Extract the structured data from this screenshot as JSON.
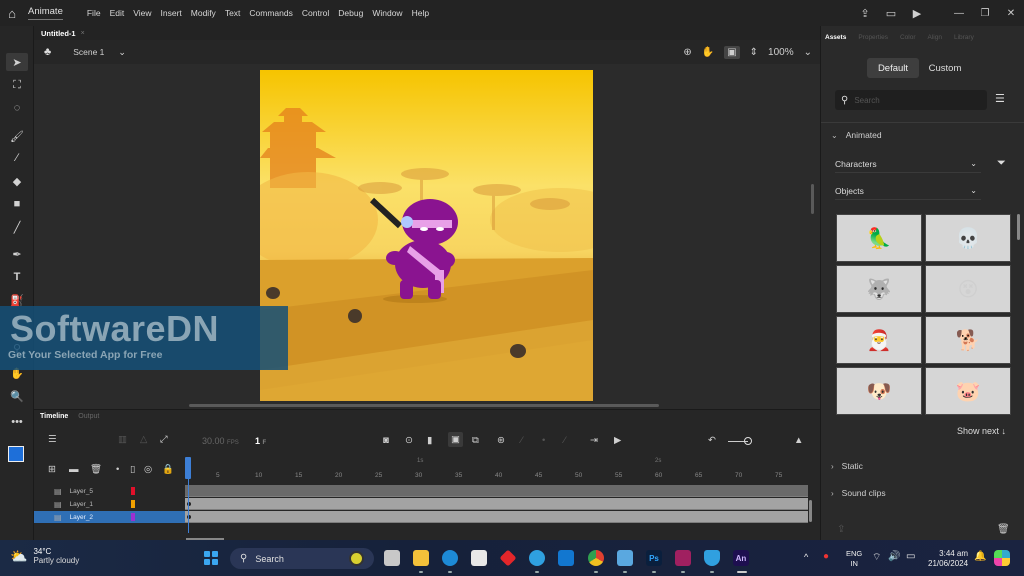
{
  "menubar": {
    "app_name": "Animate",
    "menus": [
      "File",
      "Edit",
      "View",
      "Insert",
      "Modify",
      "Text",
      "Commands",
      "Control",
      "Debug",
      "Window",
      "Help"
    ],
    "icons": [
      "share-icon",
      "workspace-icon",
      "play-preview-icon"
    ],
    "window_controls": [
      "minimize-icon",
      "restore-icon",
      "close-icon"
    ]
  },
  "document": {
    "tab_title": "Untitled-1",
    "tab_close": "×"
  },
  "stage_toolbar": {
    "scene_label": "Scene 1",
    "zoom_value": "100%"
  },
  "toolbox": {
    "tools": [
      "selection-tool",
      "free-transform-tool",
      "lasso-tool",
      "paint-brush-tool",
      "brush-tool",
      "eraser-tool",
      "rectangle-tool",
      "line-tool",
      "pen-tool",
      "text-tool",
      "paint-bucket-tool",
      "eyedropper-tool",
      "bone-tool",
      "hand-tool",
      "zoom-tool",
      "more-tools"
    ],
    "stroke_color": "#000000",
    "fill_color": "#1e6fd9"
  },
  "watermark": {
    "title": "SoftwareDN",
    "subtitle": "Get Your Selected App for Free"
  },
  "timeline": {
    "tabs": [
      "Timeline",
      "Output"
    ],
    "fps": "30.00",
    "fps_unit": "FPS",
    "current_frame": "1",
    "frame_unit": "F",
    "ruler": [
      "5",
      "10",
      "15",
      "20",
      "25",
      "30",
      "35",
      "40",
      "45",
      "50",
      "55",
      "60",
      "65",
      "70",
      "75"
    ],
    "ruler_markers": [
      "1s",
      "2s"
    ],
    "layers": [
      {
        "name": "Layer_5",
        "color": "#e0102a",
        "selected": false
      },
      {
        "name": "Layer_1",
        "color": "#f0a000",
        "selected": false
      },
      {
        "name": "Layer_2",
        "color": "#9b30d0",
        "selected": true
      }
    ]
  },
  "right_panel": {
    "tabs": [
      "Assets",
      "Properties",
      "Color",
      "Align",
      "Library"
    ],
    "active_tab": "Assets",
    "segments": [
      "Default",
      "Custom"
    ],
    "active_segment": "Default",
    "search_placeholder": "Search",
    "sections": {
      "animated": "Animated",
      "static": "Static",
      "sound_clips": "Sound clips"
    },
    "dropdowns": {
      "category": "Characters",
      "subcategory": "Objects"
    },
    "assets": [
      {
        "name": "parrot",
        "glyph": "🦜"
      },
      {
        "name": "skeleton",
        "glyph": "💀"
      },
      {
        "name": "wolf",
        "glyph": "🐺"
      },
      {
        "name": "dazed-character",
        "glyph": "😵"
      },
      {
        "name": "santa",
        "glyph": "🎅"
      },
      {
        "name": "dog-lying",
        "glyph": "🐕"
      },
      {
        "name": "dog-sitting",
        "glyph": "🐶"
      },
      {
        "name": "pink-creature",
        "glyph": "🐷"
      }
    ],
    "show_next": "Show next ↓"
  },
  "taskbar": {
    "weather_temp": "34°C",
    "weather_desc": "Partly cloudy",
    "search_label": "Search",
    "apps": [
      {
        "name": "task-view",
        "label": "",
        "color": "#d0d0d0"
      },
      {
        "name": "file-explorer",
        "label": "",
        "color": "#f3c13a"
      },
      {
        "name": "edge",
        "label": "",
        "color": "#1d8ad6"
      },
      {
        "name": "store",
        "label": "",
        "color": "#e8e8e8"
      },
      {
        "name": "app-red",
        "label": "",
        "color": "#e3262a"
      },
      {
        "name": "app-blue-orb",
        "label": "",
        "color": "#2fa0e0"
      },
      {
        "name": "outlook",
        "label": "",
        "color": "#1277d0"
      },
      {
        "name": "chrome",
        "label": "",
        "color": "#e04030"
      },
      {
        "name": "notepad",
        "label": "",
        "color": "#5aa8e0"
      },
      {
        "name": "photoshop",
        "label": "Ps",
        "color": "#0a1f3d"
      },
      {
        "name": "winrar",
        "label": "",
        "color": "#a02060"
      },
      {
        "name": "defender",
        "label": "",
        "color": "#30a0e0"
      },
      {
        "name": "animate",
        "label": "An",
        "color": "#1e0f50"
      }
    ],
    "lang_line1": "ENG",
    "lang_line2": "IN",
    "time": "3:44 am",
    "date": "21/06/2024"
  }
}
